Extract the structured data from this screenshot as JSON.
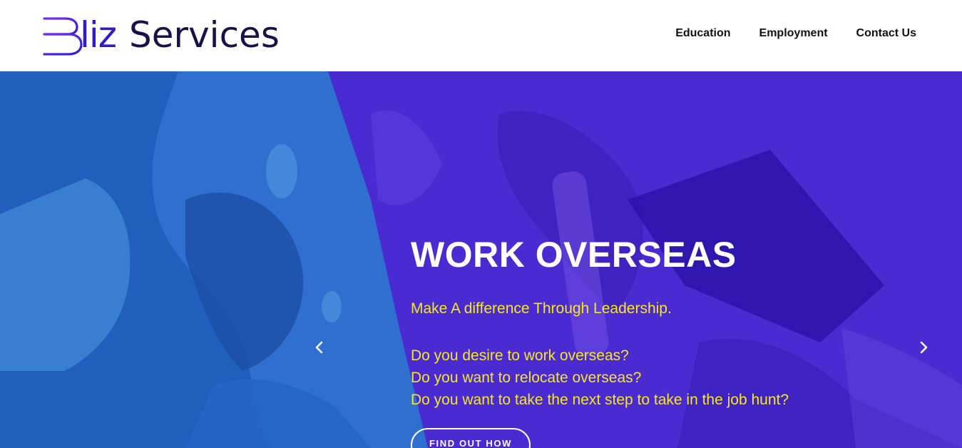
{
  "brand": {
    "logo_tail": "liz",
    "name": "Services"
  },
  "nav": [
    {
      "label": "Education"
    },
    {
      "label": "Employment"
    },
    {
      "label": "Contact Us"
    }
  ],
  "hero": {
    "title": "WORK OVERSEAS",
    "tagline": "Make A difference Through Leadership.",
    "questions": [
      "Do you desire to work overseas?",
      "Do you want to relocate overseas?",
      "Do you want to take the next step to take in the job hunt?"
    ],
    "cta_label": "FIND OUT HOW"
  },
  "icons": {
    "logo_mark": "book-stack-b-icon",
    "prev": "chevron-left-icon",
    "next": "chevron-right-icon"
  },
  "colors": {
    "brand_purple": "#2d1cc7",
    "brand_dark": "#17124a",
    "hero_blue": "#2f6fd0",
    "hero_violet": "#4a2ad1",
    "accent_yellow": "#f5e62a"
  }
}
